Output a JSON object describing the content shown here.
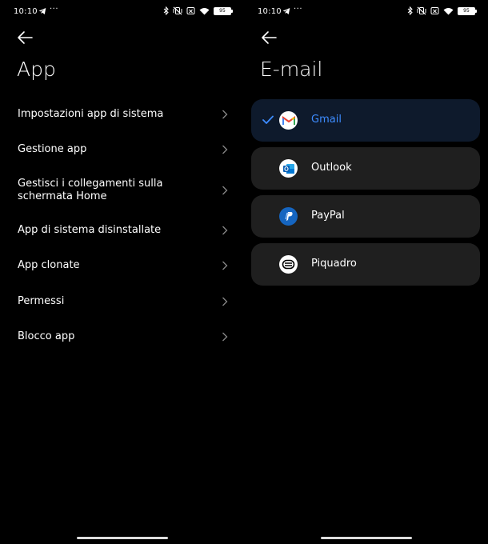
{
  "status": {
    "time": "10:10",
    "dots": "···",
    "battery": "95"
  },
  "left": {
    "title": "App",
    "items": [
      {
        "label": "Impostazioni app di sistema"
      },
      {
        "label": "Gestione app"
      },
      {
        "label": "Gestisci i collegamenti sulla schermata Home"
      },
      {
        "label": "App di sistema disinstallate"
      },
      {
        "label": "App clonate"
      },
      {
        "label": "Permessi"
      },
      {
        "label": "Blocco app"
      }
    ]
  },
  "right": {
    "title": "E-mail",
    "apps": [
      {
        "name": "Gmail",
        "icon": "gmail-icon",
        "selected": true
      },
      {
        "name": "Outlook",
        "icon": "outlook-icon",
        "selected": false
      },
      {
        "name": "PayPal",
        "icon": "paypal-icon",
        "selected": false
      },
      {
        "name": "Piquadro",
        "icon": "piquadro-icon",
        "selected": false
      }
    ]
  },
  "colors": {
    "accent": "#3d8cff",
    "card": "#1f1f1f",
    "selected_card": "#0e1a2c",
    "background": "#000000"
  }
}
